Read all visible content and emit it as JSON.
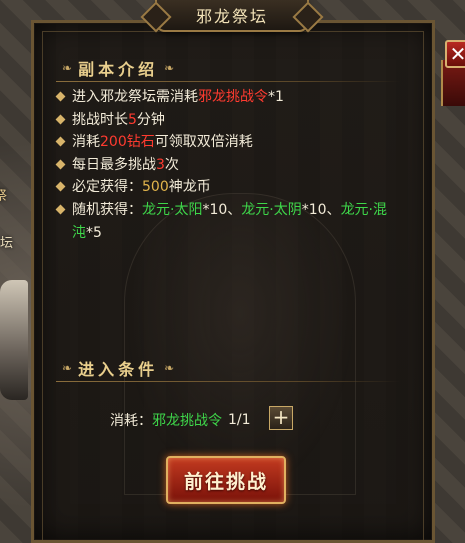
{
  "window": {
    "title": "邪龙祭坛"
  },
  "background": {
    "sign_fragment": "祭",
    "sign_fragment_2": "坛"
  },
  "intro": {
    "header": "副本介绍",
    "rules": [
      {
        "parts": [
          {
            "text": "进入邪龙祭坛需消耗"
          },
          {
            "text": "邪龙挑战令",
            "color": "red"
          },
          {
            "text": "*1"
          }
        ]
      },
      {
        "parts": [
          {
            "text": "挑战时长"
          },
          {
            "text": "5",
            "color": "red"
          },
          {
            "text": "分钟"
          }
        ]
      },
      {
        "parts": [
          {
            "text": "消耗"
          },
          {
            "text": "200钻石",
            "color": "red"
          },
          {
            "text": "可领取双倍消耗"
          }
        ]
      },
      {
        "parts": [
          {
            "text": "每日最多挑战"
          },
          {
            "text": "3",
            "color": "red"
          },
          {
            "text": "次"
          }
        ]
      },
      {
        "parts": [
          {
            "text": "必定获得："
          },
          {
            "text": "500",
            "color": "gold"
          },
          {
            "text": "神龙币"
          }
        ]
      },
      {
        "parts": [
          {
            "text": "随机获得："
          },
          {
            "text": "龙元·太阳",
            "color": "green"
          },
          {
            "text": "*10、"
          },
          {
            "text": "龙元·太阴",
            "color": "green"
          },
          {
            "text": "*10、"
          },
          {
            "text": "龙元·混沌",
            "color": "green"
          },
          {
            "text": "*5"
          }
        ]
      }
    ]
  },
  "conditions": {
    "header": "进入条件",
    "cost_label": "消耗：",
    "item_name": "邪龙挑战令",
    "count": "1/1",
    "add_icon": "plus-icon"
  },
  "actions": {
    "challenge_label": "前往挑战"
  },
  "close_icon": "close-icon",
  "colors": {
    "red": "#ff3b30",
    "green": "#3ed64a",
    "gold": "#e2b54c",
    "frame": "#6a5533"
  }
}
